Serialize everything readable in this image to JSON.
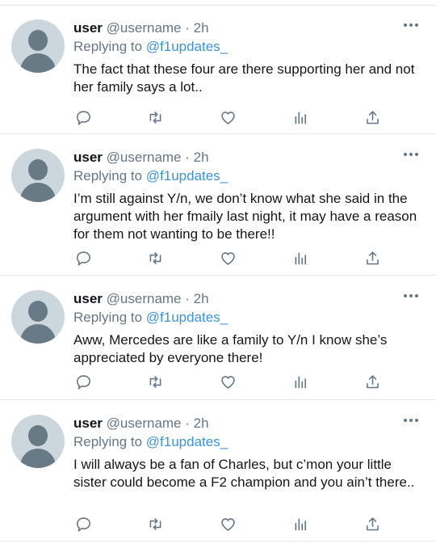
{
  "icons": {
    "more": "more-horizontal-icon",
    "reply": "comment-icon",
    "retweet": "retweet-icon",
    "like": "heart-icon",
    "analytics": "analytics-icon",
    "share": "share-icon"
  },
  "colors": {
    "link": "#3b94d9",
    "muted": "#657786",
    "avatar_bg": "#ccd6dd",
    "avatar_fg": "#687a86"
  },
  "tweets": [
    {
      "name": "user",
      "handle": "@username",
      "separator": "·",
      "time": "2h",
      "replying_prefix": "Replying to",
      "replying_to": "@f1updates_",
      "text": "The fact that these four are there supporting her and not her family says a lot.."
    },
    {
      "name": "user",
      "handle": "@username",
      "separator": "·",
      "time": "2h",
      "replying_prefix": "Replying to",
      "replying_to": "@f1updates_",
      "text": "I’m still against Y/n, we don’t know what she said in the argument with her fmaily last night, it may have a reason for them not wanting to be there!!"
    },
    {
      "name": "user",
      "handle": "@username",
      "separator": "·",
      "time": "2h",
      "replying_prefix": "Replying to",
      "replying_to": "@f1updates_",
      "text": "Aww, Mercedes are like a family to Y/n I know she’s appreciated by everyone there!"
    },
    {
      "name": "user",
      "handle": "@username",
      "separator": "·",
      "time": "2h",
      "replying_prefix": "Replying to",
      "replying_to": "@f1updates_",
      "text": "I will always be a fan of Charles, but c’mon your little sister could become a F2 champion and you ain’t there.."
    }
  ]
}
